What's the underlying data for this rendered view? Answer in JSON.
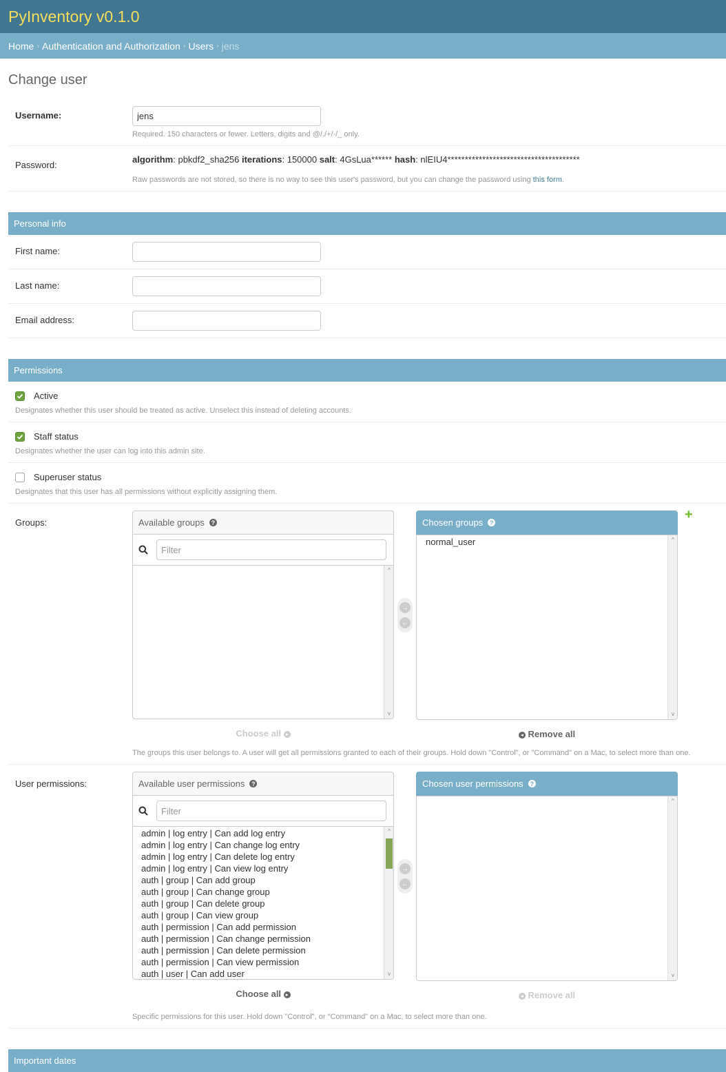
{
  "header": {
    "title": "PyInventory v0.1.0"
  },
  "breadcrumbs": {
    "home": "Home",
    "app": "Authentication and Authorization",
    "model": "Users",
    "current": "jens",
    "sep": "›"
  },
  "page_title": "Change user",
  "fields": {
    "username": {
      "label": "Username:",
      "value": "jens",
      "help": "Required. 150 characters or fewer. Letters, digits and @/./+/-/_ only."
    },
    "password": {
      "label": "Password:",
      "algorithm_key": "algorithm",
      "algorithm_val": ": pbkdf2_sha256 ",
      "iterations_key": "iterations",
      "iterations_val": ": 150000 ",
      "salt_key": "salt",
      "salt_val": ": 4GsLua****** ",
      "hash_key": "hash",
      "hash_val": ": nlEIU4**************************************",
      "help_prefix": "Raw passwords are not stored, so there is no way to see this user's password, but you can change the password using ",
      "help_link": "this form",
      "help_suffix": "."
    }
  },
  "personal_info": {
    "title": "Personal info",
    "first_name": {
      "label": "First name:",
      "value": ""
    },
    "last_name": {
      "label": "Last name:",
      "value": ""
    },
    "email": {
      "label": "Email address:",
      "value": ""
    }
  },
  "permissions": {
    "title": "Permissions",
    "active": {
      "label": "Active",
      "checked": true,
      "help": "Designates whether this user should be treated as active. Unselect this instead of deleting accounts."
    },
    "staff": {
      "label": "Staff status",
      "checked": true,
      "help": "Designates whether the user can log into this admin site."
    },
    "superuser": {
      "label": "Superuser status",
      "checked": false,
      "help": "Designates that this user has all permissions without explicitly assigning them."
    },
    "groups": {
      "label": "Groups:",
      "available_title": "Available groups",
      "chosen_title": "Chosen groups",
      "filter_placeholder": "Filter",
      "available": [],
      "chosen": [
        "normal_user"
      ],
      "choose_all": "Choose all",
      "remove_all": "Remove all",
      "help": "The groups this user belongs to. A user will get all permissions granted to each of their groups. Hold down \"Control\", or \"Command\" on a Mac, to select more than one."
    },
    "user_permissions": {
      "label": "User permissions:",
      "available_title": "Available user permissions",
      "chosen_title": "Chosen user permissions",
      "filter_placeholder": "Filter",
      "available": [
        "admin | log entry | Can add log entry",
        "admin | log entry | Can change log entry",
        "admin | log entry | Can delete log entry",
        "admin | log entry | Can view log entry",
        "auth | group | Can add group",
        "auth | group | Can change group",
        "auth | group | Can delete group",
        "auth | group | Can view group",
        "auth | permission | Can add permission",
        "auth | permission | Can change permission",
        "auth | permission | Can delete permission",
        "auth | permission | Can view permission",
        "auth | user | Can add user"
      ],
      "chosen": [],
      "choose_all": "Choose all",
      "remove_all": "Remove all",
      "help": "Specific permissions for this user. Hold down \"Control\", or \"Command\" on a Mac, to select more than one."
    }
  },
  "important_dates": {
    "title": "Important dates"
  },
  "colors": {
    "header_bg": "#417690",
    "brand_text": "#f5dd5d",
    "module_bg": "#79aec8",
    "check_green": "#6ea340",
    "add_green": "#70bf2b"
  }
}
